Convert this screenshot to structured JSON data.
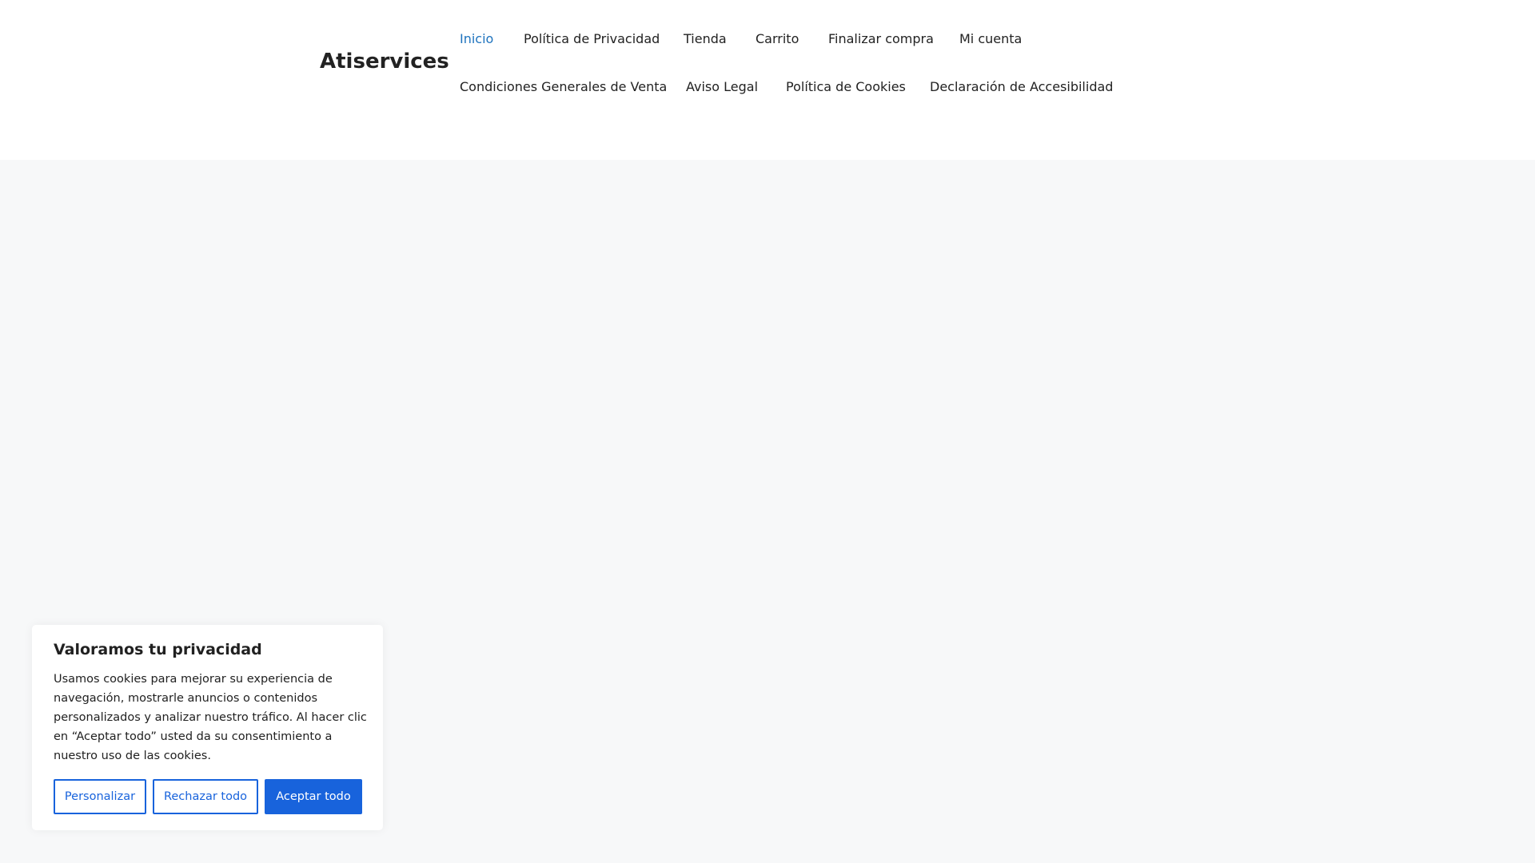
{
  "site": {
    "title": "Atiservices"
  },
  "nav": {
    "row1": [
      "Inicio",
      "Política de Privacidad",
      "Tienda",
      "Carrito",
      "Finalizar compra",
      "Mi cuenta"
    ],
    "row2": [
      "Condiciones Generales de Venta",
      "Aviso Legal",
      "Política de Cookies",
      "Declaración de Accesibilidad"
    ]
  },
  "cookie_banner": {
    "title": "Valoramos tu privacidad",
    "text": "Usamos cookies para mejorar su experiencia de navegación, mostrarle anuncios o contenidos personalizados y analizar nuestro tráfico. Al hacer clic en “Aceptar todo” usted da su consentimiento a nuestro uso de las cookies.",
    "customize": "Personalizar",
    "reject": "Rechazar todo",
    "accept": "Aceptar todo"
  },
  "colors": {
    "accent": "#1863dc",
    "link_active": "#1e73be"
  }
}
